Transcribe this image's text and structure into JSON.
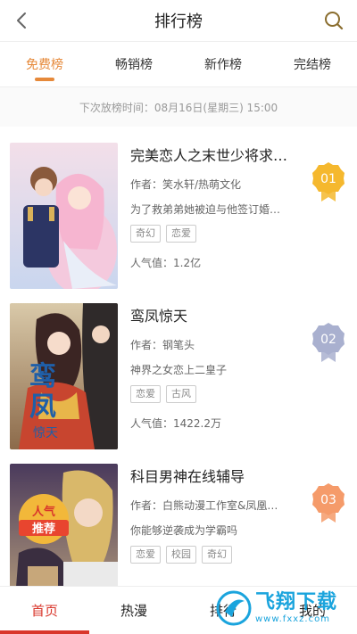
{
  "header": {
    "title": "排行榜"
  },
  "tabs": [
    {
      "label": "免费榜",
      "active": true
    },
    {
      "label": "畅销榜",
      "active": false
    },
    {
      "label": "新作榜",
      "active": false
    },
    {
      "label": "完结榜",
      "active": false
    }
  ],
  "schedule": {
    "text": "下次放榜时间：08月16日(星期三) 15:00"
  },
  "books": [
    {
      "title": "完美恋人之末世少将求…",
      "author": "作者：笑水轩/热萌文化",
      "desc": "为了救弟弟她被迫与他签订婚…",
      "tags": [
        "奇幻",
        "恋爱"
      ],
      "popularity": "人气值：1.2亿",
      "rank": "01",
      "rank_color": "#f5b82e"
    },
    {
      "title": "鸾凤惊天",
      "author": "作者：钢笔头",
      "desc": "神界之女恋上二皇子",
      "tags": [
        "恋爱",
        "古风"
      ],
      "popularity": "人气值：1422.2万",
      "rank": "02",
      "rank_color": "#a9b0cf"
    },
    {
      "title": "科目男神在线辅导",
      "author": "作者：白熊动漫工作室&凤凰…",
      "desc": "你能够逆袭成为学霸吗",
      "tags": [
        "恋爱",
        "校园",
        "奇幻"
      ],
      "popularity": "",
      "rank": "03",
      "rank_color": "#f59b6a",
      "cover_badge": [
        "人气",
        "推荐"
      ]
    }
  ],
  "bottom_nav": [
    {
      "label": "首页",
      "active": true
    },
    {
      "label": "热漫",
      "active": false
    },
    {
      "label": "排行",
      "active": false
    },
    {
      "label": "我的",
      "active": false
    }
  ],
  "watermark": {
    "main": "飞翔下载",
    "sub": "www.fxxz.com"
  }
}
